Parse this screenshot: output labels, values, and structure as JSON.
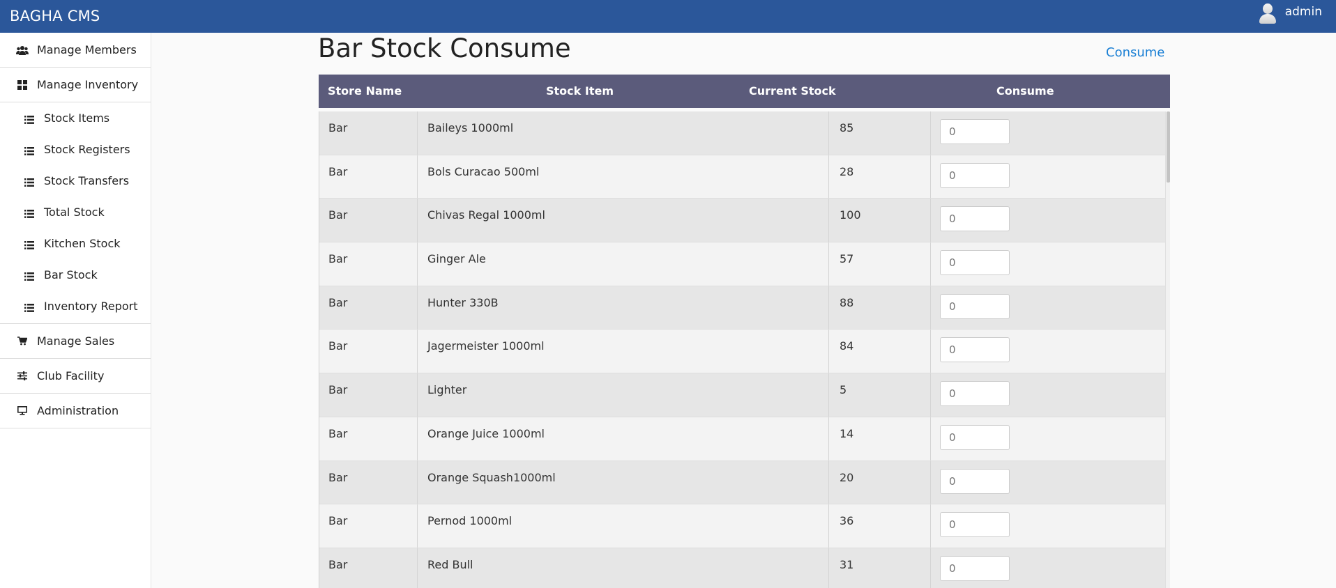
{
  "app": {
    "brand": "BAGHA CMS",
    "user": "admin"
  },
  "sidebar": {
    "items": [
      {
        "label": "Manage Members",
        "icon": "users-icon"
      },
      {
        "label": "Manage Inventory",
        "icon": "grid-icon"
      }
    ],
    "inventory_sub": [
      {
        "label": "Stock Items",
        "icon": "list-icon"
      },
      {
        "label": "Stock Registers",
        "icon": "list-icon"
      },
      {
        "label": "Stock Transfers",
        "icon": "list-icon"
      },
      {
        "label": "Total Stock",
        "icon": "list-icon"
      },
      {
        "label": "Kitchen Stock",
        "icon": "list-icon"
      },
      {
        "label": "Bar Stock",
        "icon": "list-icon"
      },
      {
        "label": "Inventory Report",
        "icon": "list-icon"
      }
    ],
    "bottom_items": [
      {
        "label": "Manage Sales",
        "icon": "cart-icon"
      },
      {
        "label": "Club Facility",
        "icon": "sliders-icon"
      },
      {
        "label": "Administration",
        "icon": "monitor-icon"
      }
    ]
  },
  "main": {
    "title": "Bar Stock Consume",
    "action_link": "Consume",
    "table": {
      "headers": [
        "Store Name",
        "Stock Item",
        "Current Stock",
        "Consume"
      ],
      "rows": [
        {
          "store": "Bar",
          "item": "Baileys 1000ml",
          "stock": "85",
          "consume": "0"
        },
        {
          "store": "Bar",
          "item": "Bols Curacao 500ml",
          "stock": "28",
          "consume": "0"
        },
        {
          "store": "Bar",
          "item": "Chivas Regal 1000ml",
          "stock": "100",
          "consume": "0"
        },
        {
          "store": "Bar",
          "item": "Ginger Ale",
          "stock": "57",
          "consume": "0"
        },
        {
          "store": "Bar",
          "item": "Hunter 330B",
          "stock": "88",
          "consume": "0"
        },
        {
          "store": "Bar",
          "item": "Jagermeister 1000ml",
          "stock": "84",
          "consume": "0"
        },
        {
          "store": "Bar",
          "item": "Lighter",
          "stock": "5",
          "consume": "0"
        },
        {
          "store": "Bar",
          "item": "Orange Juice 1000ml",
          "stock": "14",
          "consume": "0"
        },
        {
          "store": "Bar",
          "item": "Orange Squash1000ml",
          "stock": "20",
          "consume": "0"
        },
        {
          "store": "Bar",
          "item": "Pernod 1000ml",
          "stock": "36",
          "consume": "0"
        },
        {
          "store": "Bar",
          "item": "Red Bull",
          "stock": "31",
          "consume": "0"
        }
      ]
    }
  },
  "colors": {
    "topbar": "#2b579a",
    "table_header": "#5b5b7b",
    "link": "#1a7fd4"
  }
}
